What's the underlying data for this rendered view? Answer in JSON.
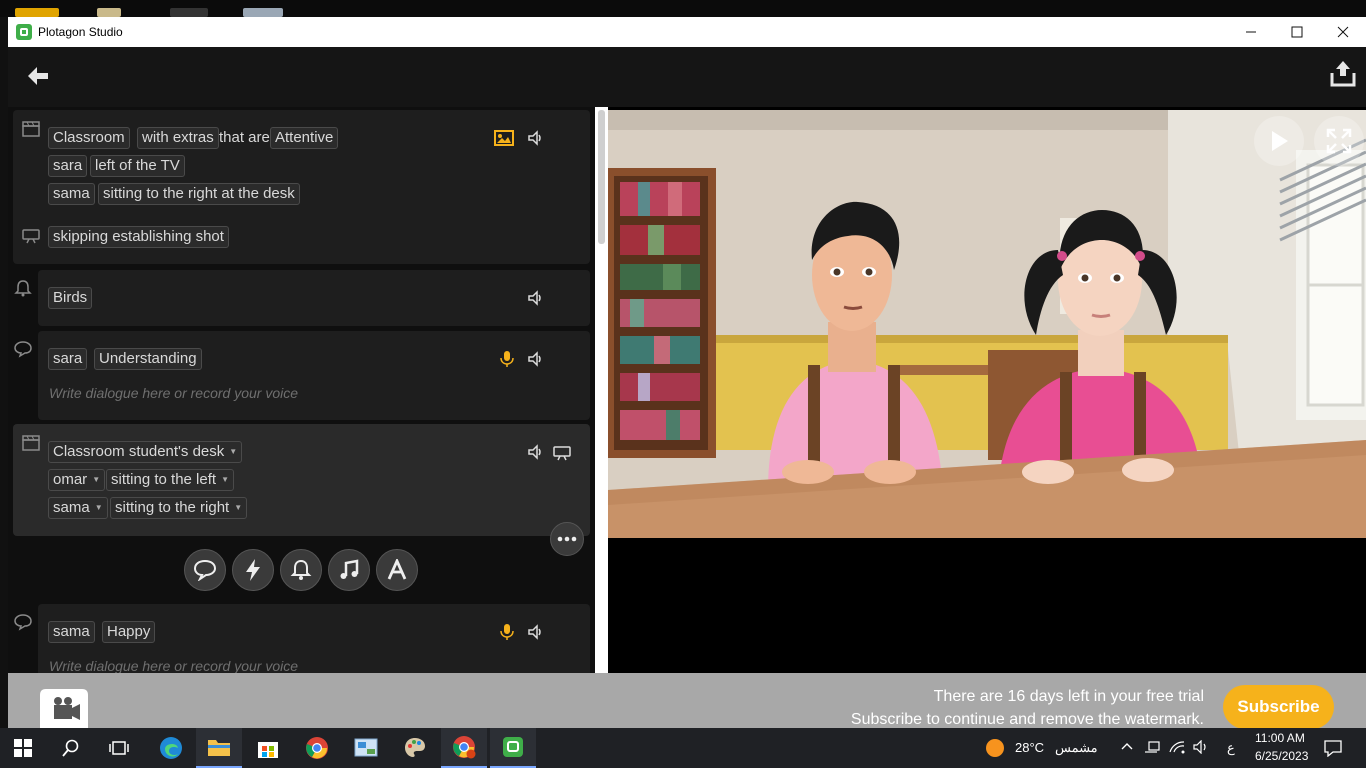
{
  "window": {
    "title": "Plotagon Studio"
  },
  "script": {
    "scene1": {
      "location": "Classroom",
      "extras": "with extras",
      "that_are": "that are",
      "extras_mood": "Attentive",
      "char1": "sara",
      "char1_pos": "left of the TV",
      "char2": "sama",
      "char2_pos": "sitting to the right at the desk",
      "shot": "skipping establishing shot"
    },
    "sound1": {
      "label": "Birds"
    },
    "dialogue1": {
      "character": "sara",
      "emotion": "Understanding",
      "placeholder": "Write dialogue here or record your voice"
    },
    "scene2": {
      "location": "Classroom student's desk",
      "char1": "omar",
      "char1_pos": "sitting to the left",
      "char2": "sama",
      "char2_pos": "sitting to the right"
    },
    "dialogue2": {
      "character": "sama",
      "emotion": "Happy",
      "placeholder": "Write dialogue here or record your voice"
    }
  },
  "trial": {
    "line1": "There are 16 days left in your free trial",
    "line2": "Subscribe to continue and remove the watermark.",
    "subscribe": "Subscribe"
  },
  "taskbar": {
    "weather": "28°C",
    "weather_label": "مشمس",
    "lang": "ع",
    "time": "11:00 AM",
    "date": "6/25/2023"
  },
  "colors": {
    "accent": "#f6b21b",
    "brand": "#3fae49"
  }
}
